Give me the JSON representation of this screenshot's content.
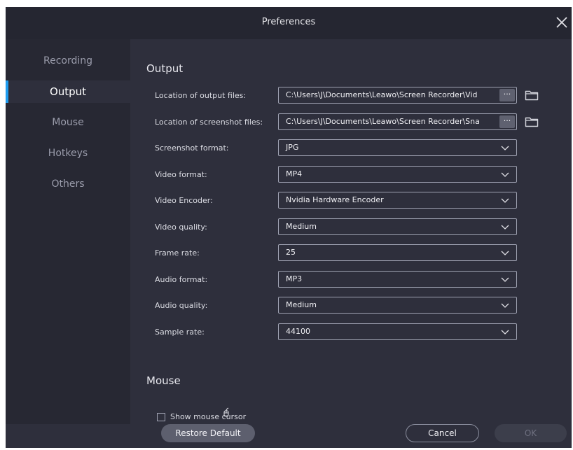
{
  "window": {
    "title": "Preferences"
  },
  "sidebar": {
    "items": [
      {
        "label": "Recording"
      },
      {
        "label": "Output",
        "active": true
      },
      {
        "label": "Mouse"
      },
      {
        "label": "Hotkeys"
      },
      {
        "label": "Others"
      }
    ]
  },
  "output": {
    "heading": "Output",
    "rows": [
      {
        "label": "Location of output files:",
        "value": "C:\\Users\\J\\Documents\\Leawo\\Screen Recorder\\Vid"
      },
      {
        "label": "Location of screenshot files:",
        "value": "C:\\Users\\J\\Documents\\Leawo\\Screen Recorder\\Sna"
      },
      {
        "label": "Screenshot format:",
        "value": "JPG"
      },
      {
        "label": "Video format:",
        "value": "MP4"
      },
      {
        "label": "Video Encoder:",
        "value": "Nvidia Hardware Encoder"
      },
      {
        "label": "Video quality:",
        "value": "Medium"
      },
      {
        "label": "Frame rate:",
        "value": "25"
      },
      {
        "label": "Audio format:",
        "value": "MP3"
      },
      {
        "label": "Audio quality:",
        "value": "Medium"
      },
      {
        "label": "Sample rate:",
        "value": "44100"
      }
    ],
    "more_label": "···"
  },
  "mouse": {
    "heading": "Mouse",
    "show_cursor_label": "Show mouse cursor",
    "show_cursor_checked": false
  },
  "footer": {
    "restore_label": "Restore Default",
    "cancel_label": "Cancel",
    "ok_label": "OK"
  },
  "icons": {
    "close": "close-icon",
    "folder": "folder-icon",
    "chevron": "chevron-down-icon",
    "cursor": "mouse-cursor-icon"
  },
  "colors": {
    "background": "#2e2f3c",
    "sidebar": "#272833",
    "titlebar": "#252631",
    "accent": "#1e9cf0",
    "field_border": "#a0a3b3",
    "button": "#5d5f6e"
  }
}
